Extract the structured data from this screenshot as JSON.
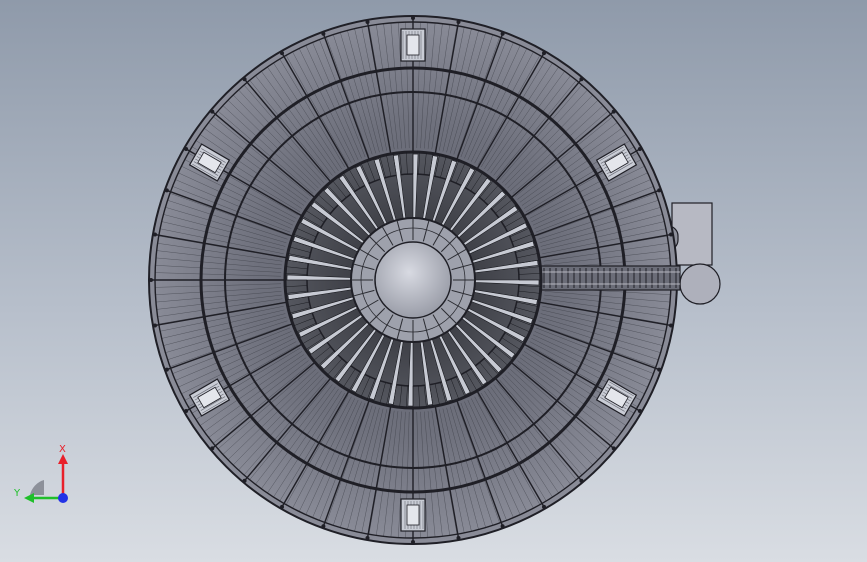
{
  "triad": {
    "x_label": "X",
    "y_label": "Y",
    "x_color": "#e8202a",
    "y_color": "#1fbf2a",
    "z_color": "#2232e6"
  },
  "model": {
    "line_color": "#1f1f26",
    "face_color": "#7d7f8c",
    "face_light": "#a5a8b4",
    "face_dark": "#4e505a",
    "hub_color": "#b8bbc6",
    "outer_ribs": 36,
    "inner_blades": 40,
    "hatches": [
      "top",
      "bottom",
      "upper-left",
      "lower-left",
      "upper-right",
      "lower-right"
    ],
    "side_box": "control-box"
  }
}
